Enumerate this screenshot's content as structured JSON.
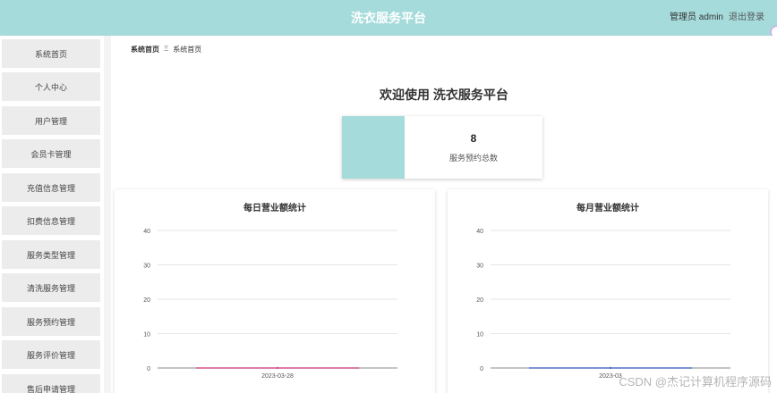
{
  "header": {
    "title": "洗衣服务平台",
    "user_label": "管理员 admin",
    "logout_label": "退出登录"
  },
  "sidebar": {
    "items": [
      {
        "label": "系统首页"
      },
      {
        "label": "个人中心"
      },
      {
        "label": "用户管理"
      },
      {
        "label": "会员卡管理"
      },
      {
        "label": "充值信息管理"
      },
      {
        "label": "扣费信息管理"
      },
      {
        "label": "服务类型管理"
      },
      {
        "label": "清洗服务管理"
      },
      {
        "label": "服务预约管理"
      },
      {
        "label": "服务评价管理"
      },
      {
        "label": "售后申请管理"
      }
    ]
  },
  "breadcrumb": {
    "home": "系统首页",
    "separator": "Ξ",
    "current": "系统首页"
  },
  "main": {
    "welcome": "欢迎使用 洗衣服务平台"
  },
  "stat": {
    "value": "8",
    "label": "服务预约总数"
  },
  "watermark": "CSDN @杰记计算机程序源码",
  "colors": {
    "accent": "#a6dbdb",
    "line_daily": "#d4548a",
    "line_monthly": "#5470c6"
  },
  "chart_data": [
    {
      "type": "line",
      "title": "每日营业额统计",
      "x": [
        "2023-03-28"
      ],
      "series": [
        {
          "values": [
            0
          ]
        }
      ],
      "ylim": [
        0,
        40
      ],
      "yticks": [
        0,
        10,
        20,
        30,
        40
      ],
      "grid": true
    },
    {
      "type": "line",
      "title": "每月营业额统计",
      "x": [
        "2023-03"
      ],
      "series": [
        {
          "values": [
            0
          ]
        }
      ],
      "ylim": [
        0,
        40
      ],
      "yticks": [
        0,
        10,
        20,
        30,
        40
      ],
      "grid": true
    }
  ]
}
